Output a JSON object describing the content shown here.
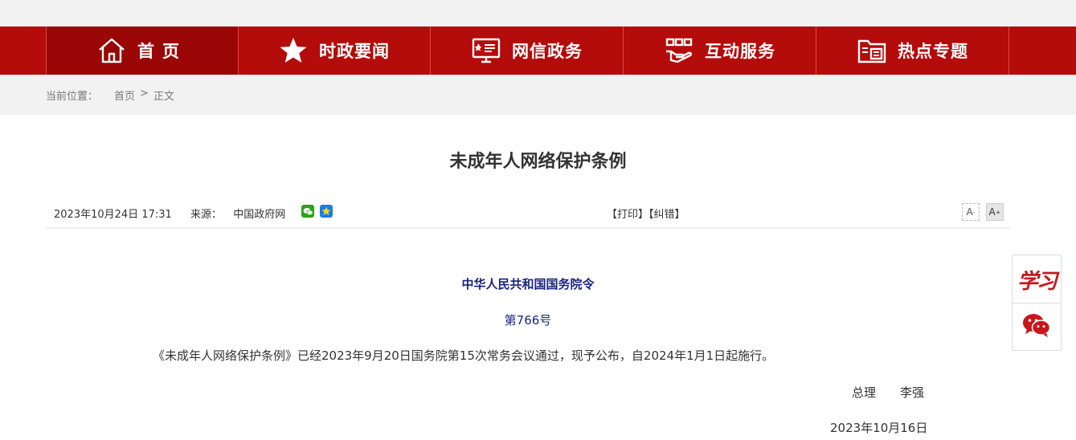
{
  "nav": {
    "items": [
      {
        "label": "首页",
        "icon": "home-icon"
      },
      {
        "label": "时政要闻",
        "icon": "star-icon"
      },
      {
        "label": "网信政务",
        "icon": "monitor-icon"
      },
      {
        "label": "互动服务",
        "icon": "hand-service-icon"
      },
      {
        "label": "热点专题",
        "icon": "folder-icon"
      }
    ],
    "color": "#b40b0b",
    "active_color": "#9a0606"
  },
  "breadcrumb": {
    "prefix": "当前位置：",
    "home": "首页",
    "sep": ">",
    "current": "正文"
  },
  "article": {
    "title": "未成年人网络保护条例",
    "date": "2023年10月24日 17:31",
    "source_label": "来源：",
    "source": "中国政府网",
    "print": "【打印】",
    "correct": "【纠错】",
    "font_minus": "A",
    "font_minus_sup": "-",
    "font_plus": "A",
    "font_plus_sup": "+",
    "order_title": "中华人民共和国国务院令",
    "order_no": "第766号",
    "paragraph": "《未成年人网络保护条例》已经2023年9月20日国务院第15次常务会议通过，现予公布，自2024年1月1日起施行。",
    "sign_role": "总理",
    "sign_name": "李强",
    "sign_date": "2023年10月16日"
  },
  "float": {
    "xuexi": "学习",
    "wechat_icon": "wechat-icon"
  }
}
